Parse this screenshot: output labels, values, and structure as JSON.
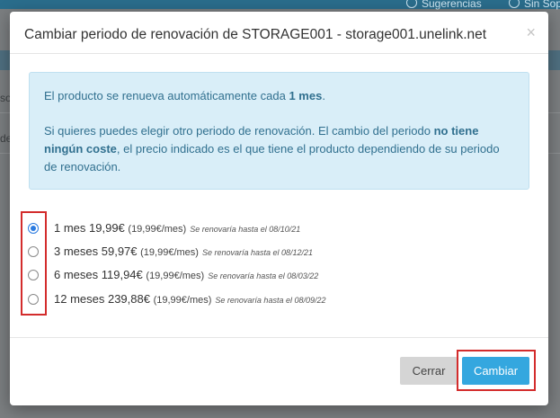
{
  "background": {
    "top_items": [
      {
        "icon": "lightbulb-icon",
        "label": "Sugerencias"
      },
      {
        "icon": "clock-icon",
        "label": "Sin Sop"
      }
    ],
    "left_fragments": [
      "so",
      "de"
    ]
  },
  "modal": {
    "title": "Cambiar periodo de renovación de STORAGE001 - storage001.unelink.net",
    "close_symbol": "×",
    "alert": {
      "p1_text": "El producto se renueva automáticamente cada ",
      "p1_bold": "1 mes",
      "p1_end": ".",
      "p2_text": "Si quieres puedes elegir otro periodo de renovación. El cambio del periodo ",
      "p2_bold": "no tiene ningún coste",
      "p2_end": ", el precio indicado es el que tiene el producto dependiendo de su periodo de renovación."
    },
    "options": [
      {
        "label": "1 mes 19,99€",
        "per": "(19,99€/mes)",
        "note": "Se renovaría hasta el 08/10/21",
        "checked": true
      },
      {
        "label": "3 meses 59,97€",
        "per": "(19,99€/mes)",
        "note": "Se renovaría hasta el 08/12/21",
        "checked": false
      },
      {
        "label": "6 meses 119,94€",
        "per": "(19,99€/mes)",
        "note": "Se renovaría hasta el 08/03/22",
        "checked": false
      },
      {
        "label": "12 meses 239,88€",
        "per": "(19,99€/mes)",
        "note": "Se renovaría hasta el 08/09/22",
        "checked": false
      }
    ],
    "buttons": {
      "close_label": "Cerrar",
      "change_label": "Cambiar"
    }
  },
  "colors": {
    "primary": "#34a7df",
    "alert_bg": "#d9eef8",
    "alert_text": "#31708f",
    "highlight": "#d32c2c",
    "radio_checked": "#2b7be0"
  }
}
